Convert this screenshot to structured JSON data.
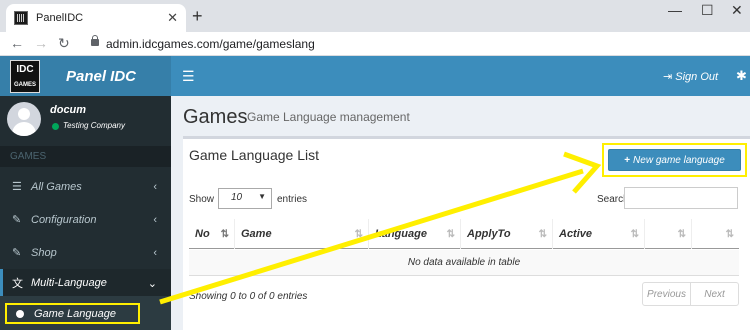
{
  "browser": {
    "tab_title": "PanelIDC",
    "url": "admin.idcgames.com/game/gameslang"
  },
  "app": {
    "logo_text": "IDC",
    "brand": "Panel IDC",
    "signout_label": "Sign Out"
  },
  "user": {
    "name": "docum",
    "company": "Testing Company"
  },
  "sidebar": {
    "section_header": "GAMES",
    "items": [
      {
        "label": "All Games",
        "icon": "list-icon"
      },
      {
        "label": "Configuration",
        "icon": "edit-icon"
      },
      {
        "label": "Shop",
        "icon": "edit-icon"
      },
      {
        "label": "Multi-Language",
        "icon": "language-icon"
      }
    ],
    "subitem": "Game Language"
  },
  "page": {
    "title": "Games",
    "subtitle": "Game Language management"
  },
  "box": {
    "title": "Game Language List",
    "new_button": "New game language",
    "show_label": "Show",
    "entries_value": "10",
    "entries_label": "entries",
    "search_label": "Search:",
    "columns": [
      "No",
      "Game",
      "Language",
      "ApplyTo",
      "Active",
      "",
      ""
    ],
    "empty_text": "No data available in table",
    "info_text": "Showing 0 to 0 of 0 entries",
    "prev_label": "Previous",
    "next_label": "Next"
  },
  "colors": {
    "accent": "#3c8dbc",
    "sidebar_bg": "#222d32",
    "highlight": "#ffef00"
  }
}
